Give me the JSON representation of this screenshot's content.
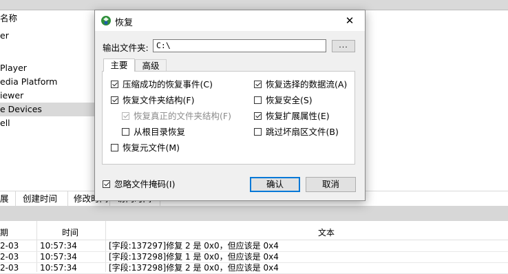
{
  "background": {
    "list_items": [
      {
        "label": "名称",
        "selected": false
      },
      {
        "label": "er",
        "selected": false
      },
      {
        "label": "",
        "selected": false
      },
      {
        "label": "Player",
        "selected": false
      },
      {
        "label": "edia Platform",
        "selected": false
      },
      {
        "label": "iewer",
        "selected": false
      },
      {
        "label": "e Devices",
        "selected": true
      },
      {
        "label": "ell",
        "selected": false
      }
    ],
    "columns": [
      "展",
      "创建时间",
      "修改时间",
      "访问时间"
    ],
    "log": {
      "headers": {
        "date": "期",
        "time": "时间",
        "text": "文本"
      },
      "rows": [
        {
          "date": "2-03",
          "time": "10:57:34",
          "text": "[字段:137297]修复 2 是 0x0，但应该是 0x4"
        },
        {
          "date": "2-03",
          "time": "10:57:34",
          "text": "[字段:137298]修复 1 是 0x0，但应该是 0x4"
        },
        {
          "date": "2-03",
          "time": "10:57:34",
          "text": "[字段:137298]修复 2 是 0x0，但应该是 0x4"
        }
      ]
    }
  },
  "dialog": {
    "title": "恢复",
    "close_glyph": "✕",
    "output_label": "输出文件夹:",
    "output_value": "C:\\",
    "browse_label": "...",
    "tabs": [
      {
        "label": "主要",
        "active": true
      },
      {
        "label": "高级",
        "active": false
      }
    ],
    "left_options": [
      {
        "label": "压缩成功的恢复事件(C)",
        "checked": true,
        "disabled": false,
        "indent": 0
      },
      {
        "label": "恢复文件夹结构(F)",
        "checked": true,
        "disabled": false,
        "indent": 0
      },
      {
        "label": "恢复真正的文件夹结构(F)",
        "checked": true,
        "disabled": true,
        "indent": 1
      },
      {
        "label": "从根目录恢复",
        "checked": false,
        "disabled": false,
        "indent": 1
      },
      {
        "label": "恢复元文件(M)",
        "checked": false,
        "disabled": false,
        "indent": 0
      }
    ],
    "right_options": [
      {
        "label": "恢复选择的数据流(A)",
        "checked": true,
        "disabled": false
      },
      {
        "label": "恢复安全(S)",
        "checked": false,
        "disabled": false
      },
      {
        "label": "恢复扩展属性(E)",
        "checked": true,
        "disabled": false
      },
      {
        "label": "跳过坏扇区文件(B)",
        "checked": false,
        "disabled": false
      }
    ],
    "ignore_mask": {
      "label": "忽略文件掩码(I)",
      "checked": true
    },
    "ok_label": "确认",
    "cancel_label": "取消",
    "accent_color": "#0078d7"
  }
}
